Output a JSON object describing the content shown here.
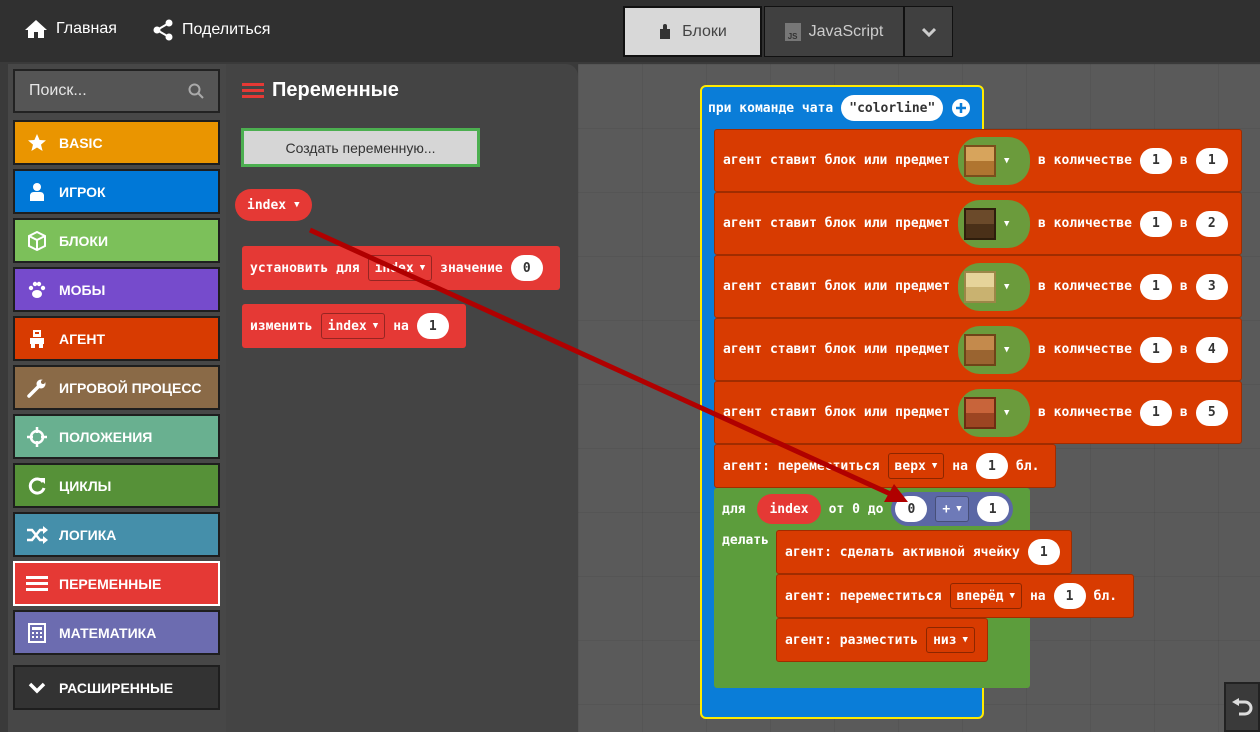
{
  "topbar": {
    "home_label": "Главная",
    "share_label": "Поделиться",
    "blocks_tab": "Блоки",
    "js_tab": "JavaScript"
  },
  "toolbox": {
    "search_placeholder": "Поиск...",
    "categories": [
      {
        "label": "BASIC",
        "color": "#ea9500",
        "icon": "star-icon"
      },
      {
        "label": "ИГРОК",
        "color": "#0078d7",
        "icon": "person-icon"
      },
      {
        "label": "БЛОКИ",
        "color": "#7cc05a",
        "icon": "cube-icon"
      },
      {
        "label": "МОБЫ",
        "color": "#764bcc",
        "icon": "paw-icon"
      },
      {
        "label": "АГЕНТ",
        "color": "#d83b01",
        "icon": "robot-icon"
      },
      {
        "label": "ИГРОВОЙ ПРОЦЕСС",
        "color": "#8a6a47",
        "icon": "wrench-icon"
      },
      {
        "label": "ПОЛОЖЕНИЯ",
        "color": "#69b090",
        "icon": "crosshair-icon"
      },
      {
        "label": "ЦИКЛЫ",
        "color": "#569138",
        "icon": "loop-icon"
      },
      {
        "label": "ЛОГИКА",
        "color": "#458faa",
        "icon": "shuffle-icon"
      },
      {
        "label": "ПЕРЕМЕННЫЕ",
        "color": "#e53935",
        "icon": "list-icon"
      },
      {
        "label": "МАТЕМАТИКА",
        "color": "#6c6cb0",
        "icon": "calculator-icon"
      }
    ],
    "advanced_label": "РАСШИРЕННЫЕ"
  },
  "flyout": {
    "title": "Переменные",
    "create_button": "Создать переменную...",
    "var_name": "index",
    "set_block": {
      "prefix": "установить для",
      "var": "index",
      "mid": "значение",
      "value": "0"
    },
    "change_block": {
      "prefix": "изменить",
      "var": "index",
      "mid": "на",
      "value": "1"
    }
  },
  "workspace": {
    "event_label": "при команде чата",
    "event_command": "colorline",
    "place_rows": [
      {
        "label": "агент ставит блок или предмет",
        "qty_label": "в количестве",
        "qty": "1",
        "slot_label": "в",
        "slot": "1",
        "item": "planks-icon"
      },
      {
        "label": "агент ставит блок или предмет",
        "qty_label": "в количестве",
        "qty": "1",
        "slot_label": "в",
        "slot": "2",
        "item": "dark-planks-icon"
      },
      {
        "label": "агент ставит блок или предмет",
        "qty_label": "в количестве",
        "qty": "1",
        "slot_label": "в",
        "slot": "3",
        "item": "birch-planks-icon"
      },
      {
        "label": "агент ставит блок или предмет",
        "qty_label": "в количестве",
        "qty": "1",
        "slot_label": "в",
        "slot": "4",
        "item": "oak-planks-icon"
      },
      {
        "label": "агент ставит блок или предмет",
        "qty_label": "в количестве",
        "qty": "1",
        "slot_label": "в",
        "slot": "5",
        "item": "acacia-planks-icon"
      }
    ],
    "move_up": {
      "label": "агент: переместиться",
      "dir": "верх",
      "on": "на",
      "n": "1",
      "unit": "бл."
    },
    "loop": {
      "for": "для",
      "var": "index",
      "from": "от 0 до",
      "left": "0",
      "op": "+",
      "right": "1",
      "do": "делать"
    },
    "inner": {
      "select_label": "агент: сделать активной ячейку",
      "select_n": "1",
      "move_label": "агент: переместиться",
      "move_dir": "вперёд",
      "move_on": "на",
      "move_n": "1",
      "move_unit": "бл.",
      "place_label": "агент: разместить",
      "place_dir": "низ"
    }
  }
}
